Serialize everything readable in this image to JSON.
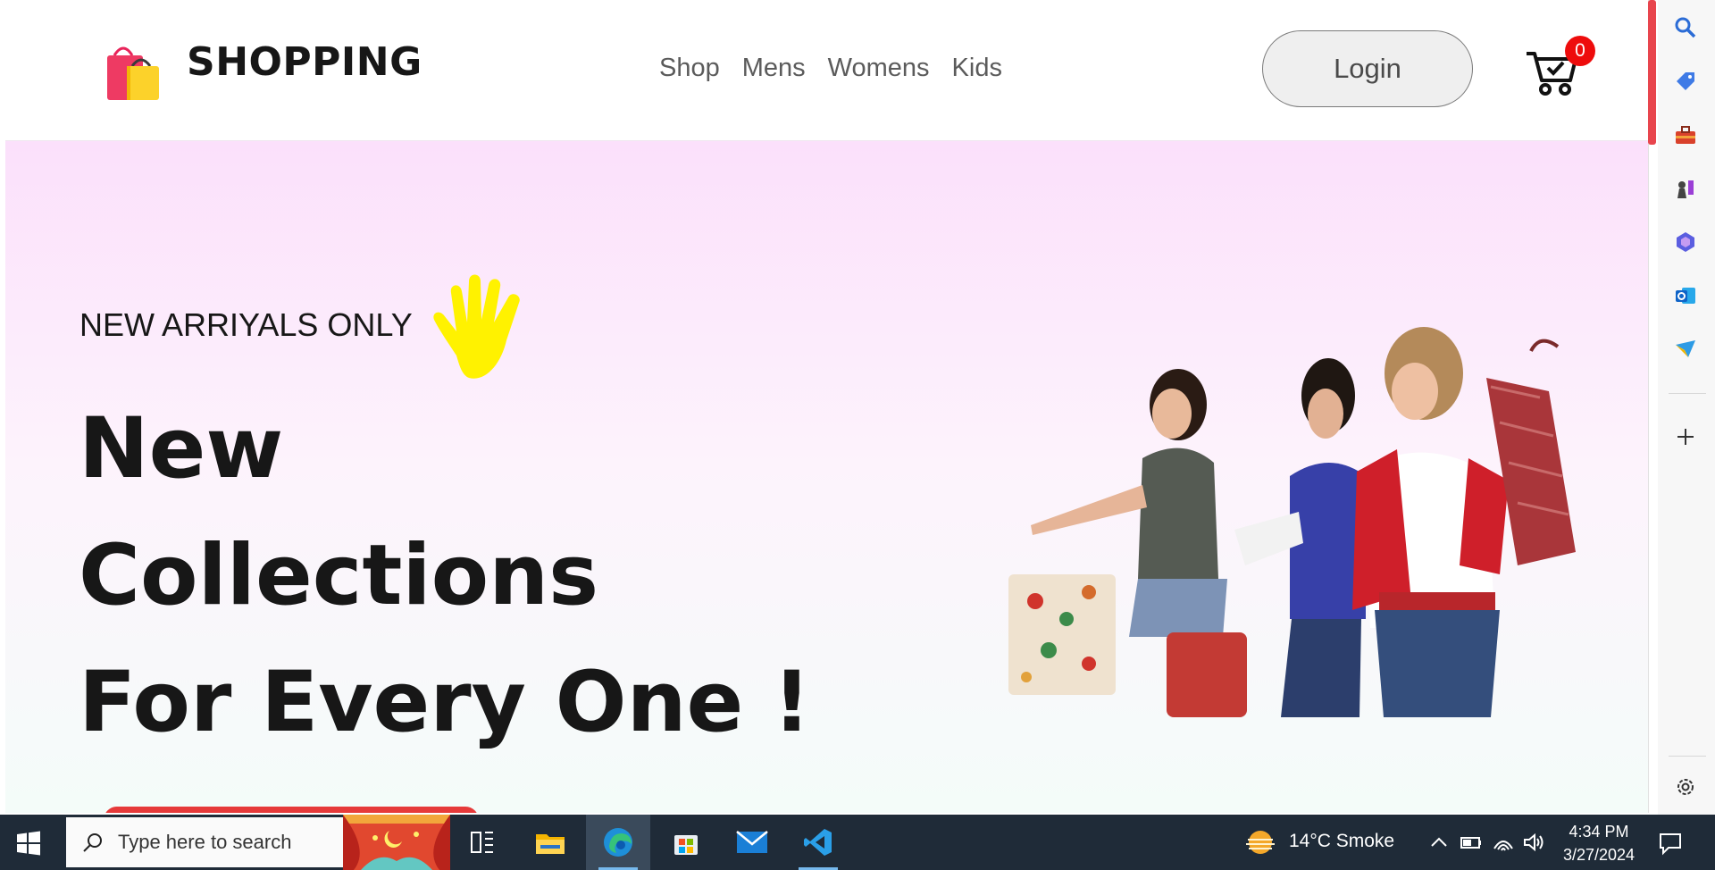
{
  "site": {
    "brand": "SHOPPING",
    "nav": [
      "Shop",
      "Mens",
      "Womens",
      "Kids"
    ],
    "login_label": "Login",
    "cart_count": "0"
  },
  "hero": {
    "tagline": "NEW ARRIYALS ONLY",
    "headline": [
      "New",
      "Collections",
      "For Every One !"
    ]
  },
  "taskbar": {
    "search_placeholder": "Type here to search",
    "weather": "14°C  Smoke",
    "time": "4:34 PM",
    "date": "3/27/2024"
  },
  "sidebar_icons": [
    "search-icon",
    "tag-icon",
    "toolbox-icon",
    "chess-icon",
    "copilot-icon",
    "outlook-icon",
    "send-icon",
    "plus-icon",
    "settings-icon"
  ],
  "colors": {
    "accent_red": "#ee0c0c",
    "hero_top": "#fbe0fb",
    "hero_bottom": "#f4fcf9",
    "taskbar": "#1f2b38"
  }
}
